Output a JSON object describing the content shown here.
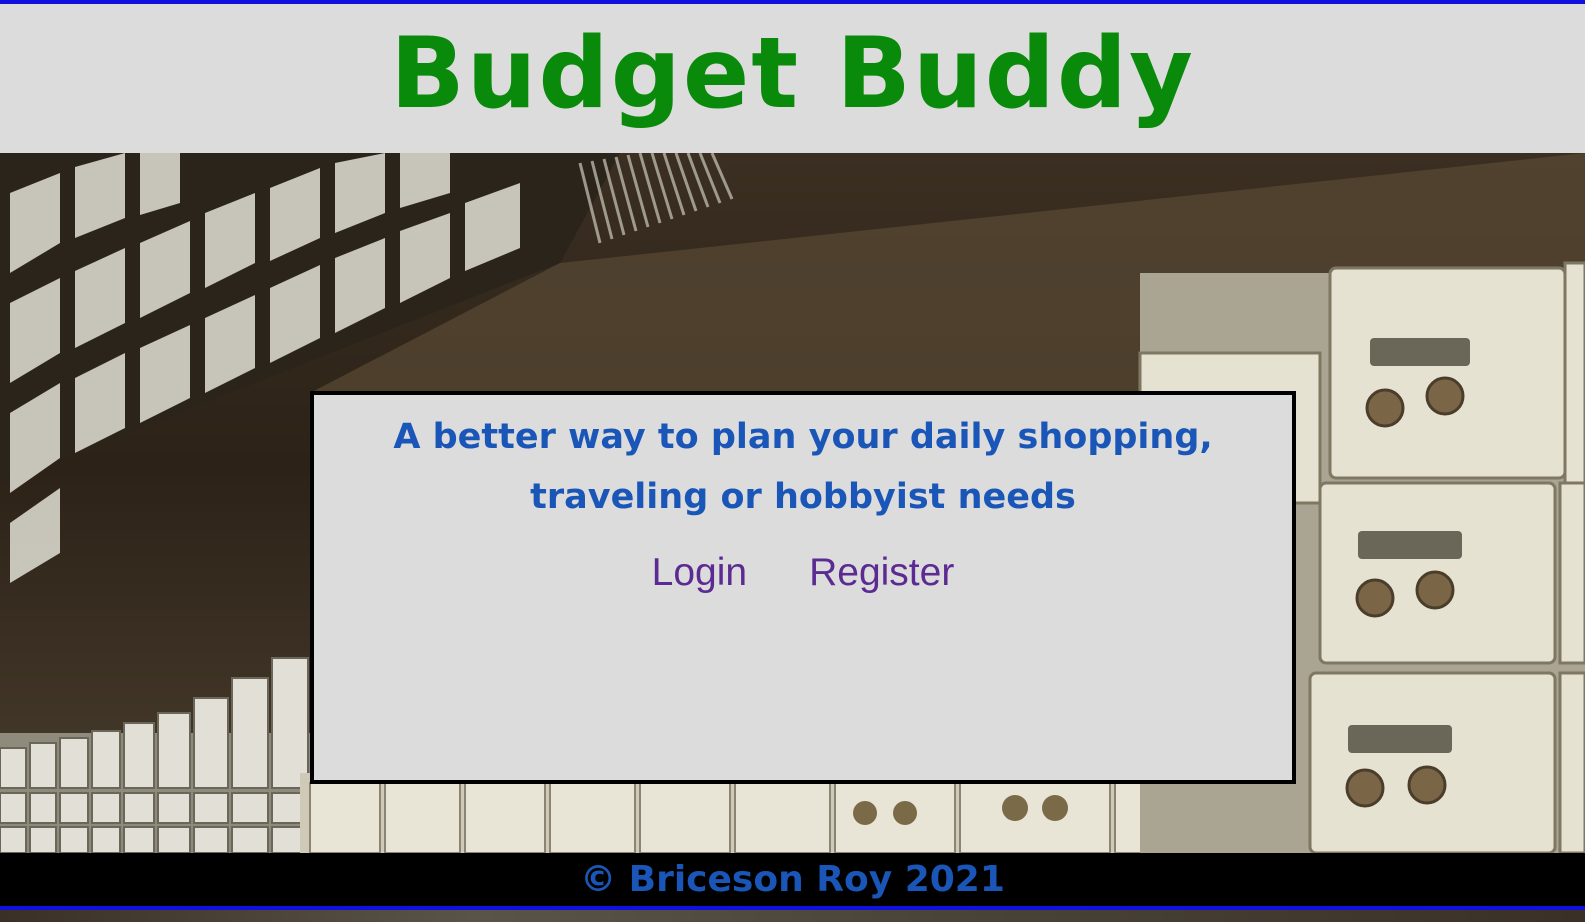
{
  "header": {
    "title": "Budget Buddy"
  },
  "card": {
    "tagline": "A better way to plan your daily shopping, traveling or hobbyist needs",
    "login_label": "Login",
    "register_label": "Register"
  },
  "footer": {
    "copyright": "© Briceson Roy 2021"
  },
  "colors": {
    "title_green": "#0a8a0a",
    "tagline_blue": "#1a56b8",
    "link_purple": "#5b2a92",
    "panel_gray": "#dcdcdc",
    "border_blue": "#1010e0"
  }
}
